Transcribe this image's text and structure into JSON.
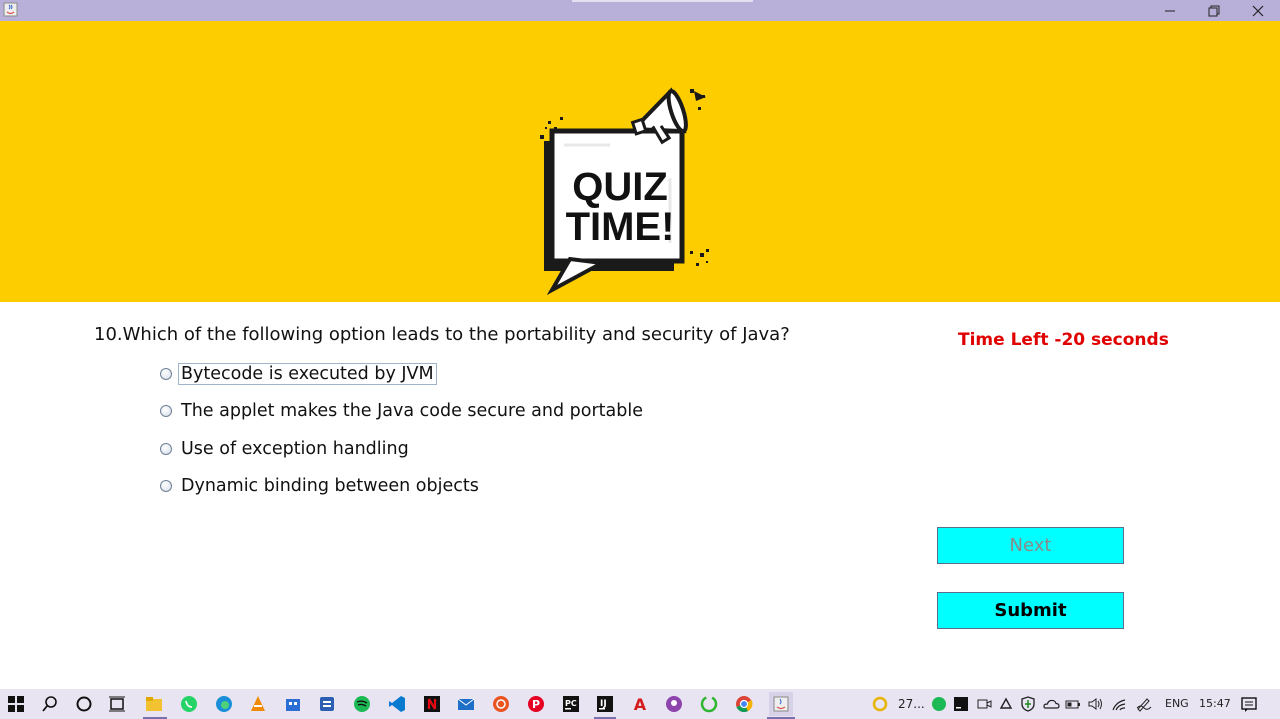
{
  "window": {
    "controls": {
      "minimize": "–",
      "restore": "⧉",
      "close": "✕"
    }
  },
  "banner": {
    "background": "#fecd00",
    "logo_text": [
      "QUIZ",
      "TIME!"
    ]
  },
  "quiz": {
    "question": "10.Which of the following option leads to the portability and security of Java?",
    "timer": "Time Left -20 seconds",
    "options": [
      {
        "label": "Bytecode is executed by JVM",
        "focused": true
      },
      {
        "label": "The applet makes the Java code secure and portable"
      },
      {
        "label": "Use of exception handling"
      },
      {
        "label": "Dynamic binding between objects"
      }
    ],
    "next_label": "Next",
    "submit_label": "Submit",
    "button_color": "#00ffff",
    "timer_color": "#e00000"
  },
  "taskbar": {
    "pinned_icons": [
      "windows-start-icon",
      "search-icon",
      "cortana-icon",
      "task-view-icon",
      "file-explorer-icon",
      "whatsapp-icon",
      "edge-icon",
      "vlc-icon",
      "store-icon",
      "app-icon",
      "spotify-icon",
      "vscode-icon",
      "netflix-icon",
      "mail-icon",
      "ubuntu-icon",
      "pinterest-icon",
      "pycharm-icon",
      "intellij-icon",
      "acrobat-icon",
      "app-purple-icon",
      "app-green-icon",
      "chrome-icon",
      "java-app-icon"
    ],
    "weather": "27...",
    "tray_icons": [
      "spotify-tray-icon",
      "intellij-tray-icon",
      "meet-now-icon",
      "sync-icon",
      "defender-icon",
      "onedrive-icon",
      "battery-icon",
      "volume-icon",
      "wifi-icon",
      "pen-icon"
    ],
    "language": "ENG",
    "time": "15:47"
  }
}
